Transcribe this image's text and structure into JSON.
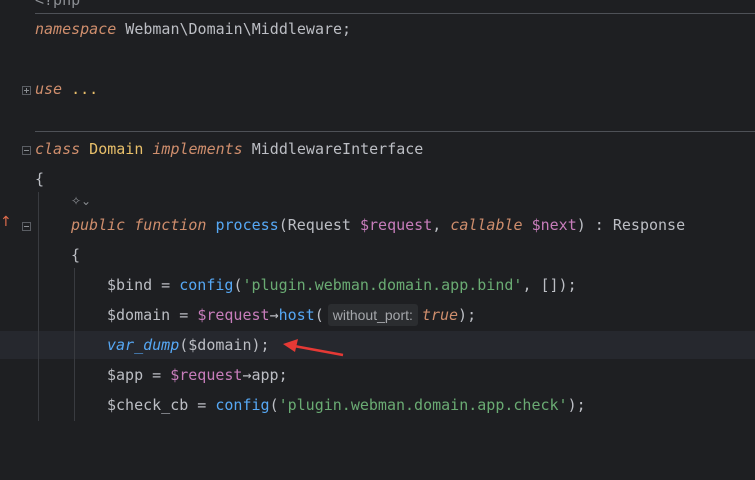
{
  "top_partial": "<?php",
  "lines": {
    "namespace_kw": "namespace",
    "namespace_name": " Webman\\Domain\\Middleware;",
    "use_kw": "use",
    "use_dots": " ...",
    "class_kw": "class",
    "class_name": " Domain",
    "implements_kw": " implements",
    "interface_name": " MiddlewareInterface",
    "open_brace": "{",
    "method_public": "public",
    "method_function": " function",
    "method_name": " process",
    "method_open": "(Request ",
    "param_request": "$request",
    "method_comma": ", ",
    "callable_kw": "callable",
    "param_next": " $next",
    "method_close": ") : Response",
    "method_brace": "{",
    "l1_var": "$bind",
    "l1_eq": " = ",
    "l1_fn": "config",
    "l1_open": "(",
    "l1_str": "'plugin.webman.domain.app.bind'",
    "l1_rest": ", []);",
    "l2_var": "$domain",
    "l2_eq": " = ",
    "l2_req": "$request",
    "l2_arrow": "→",
    "l2_fn": "host",
    "l2_open": "(",
    "l2_hint_label": "without_port:",
    "l2_hint_val": "true",
    "l2_close": ");",
    "l3_fn": "var_dump",
    "l3_rest": "($domain);",
    "l4_var": "$app",
    "l4_eq": " = ",
    "l4_req": "$request",
    "l4_arrow": "→",
    "l4_prop": "app;",
    "l5_var": "$check_cb",
    "l5_eq": " = ",
    "l5_fn": "config",
    "l5_open": "(",
    "l5_str": "'plugin.webman.domain.app.check'",
    "l5_close": ");"
  },
  "ai_icon": "✧⌄",
  "override_marker": "↑",
  "colors": {
    "background": "#1e1f22",
    "keyword": "#cf8e6d",
    "function": "#56a8f5",
    "variable": "#c77dbb",
    "string": "#6aab73",
    "annotation_arrow": "#e53935"
  }
}
